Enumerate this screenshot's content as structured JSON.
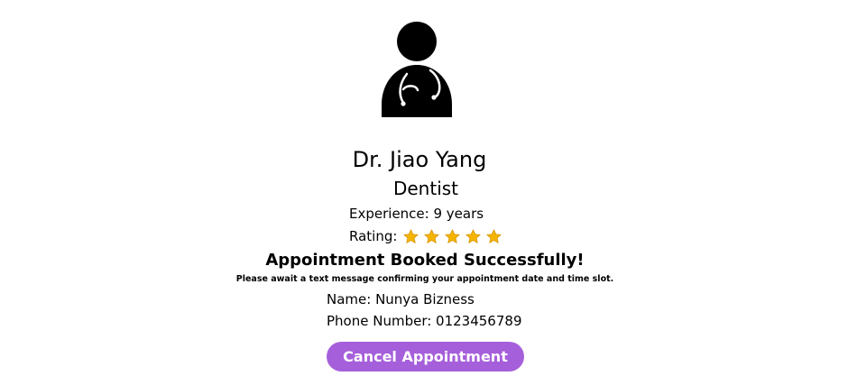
{
  "doctor": {
    "avatar_icon": "doctor-icon",
    "name": "Dr. Jiao Yang",
    "specialty": "Dentist",
    "experience": "Experience: 9 years",
    "rating_label": "Rating:",
    "rating_stars": 5,
    "star_icon": "star-icon",
    "star_color": "#F4B400"
  },
  "confirmation": {
    "title": "Appointment Booked Successfully!",
    "note": "Please await a text message confirming your appointment date and time slot."
  },
  "patient": {
    "name": "Name: Nunya Bizness",
    "phone": "Phone Number: 0123456789"
  },
  "actions": {
    "cancel_label": "Cancel Appointment",
    "accent_color": "#A65FDB"
  }
}
